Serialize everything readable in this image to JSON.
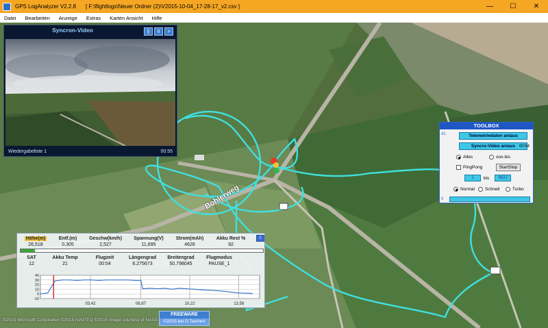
{
  "window": {
    "title": "GPS LogAnalyzer V2.2.8",
    "path": "[ F:\\flightlogs\\Neuer Ordner (2)\\V2015-10-04_17-28-17_v2.csv ]",
    "minimize": "—",
    "maximize": "☐",
    "close": "✕"
  },
  "menu": [
    "Datei",
    "Bearbeiten",
    "Anzeige",
    "Extras",
    "Karten Ansicht",
    "Hilfe"
  ],
  "video": {
    "title": "Syncron-Video",
    "buttons": [
      "||",
      "II",
      ">"
    ],
    "playlist": "Wiedergabeliste 1",
    "time": "00:55"
  },
  "toolbox": {
    "title": "TOOLBOX",
    "side_top": "41",
    "side_bottom": "0",
    "telemetry_button": "Telemetriedaten an/aus",
    "video_button": "Syncro-Video an/aus",
    "video_time": "00:54",
    "range_all": "Alles",
    "range_from_to": "von-bis",
    "pingpong": "PingPong",
    "startstop": "StartStop",
    "field_from": "1",
    "field_to_label": "bis",
    "field_to": "8621",
    "speed_normal": "Normal",
    "speed_fast": "Schnell",
    "speed_turbo": "Turbo"
  },
  "telemetry": {
    "row1_headers": [
      "Höhe(m)",
      "Entf.(m)",
      "Geschw(km/h)",
      "Spannung(V)",
      "Strom(mAh)",
      "Akku Rest %"
    ],
    "row1_values": [
      "26,518",
      "0,305",
      "2,527",
      "11,695",
      "4626",
      "92"
    ],
    "row2_headers": [
      "SAT",
      "Akku Temp",
      "Flugzeit",
      "Längengrad",
      "Breitengrad",
      "Flugmodus"
    ],
    "row2_values": [
      "12",
      "21",
      "00:54",
      "6.275673",
      "50.798045",
      "PAUSE_1"
    ],
    "button": "i",
    "akku_percent": 6
  },
  "chart_data": {
    "type": "line",
    "x": [
      0,
      0.5,
      1,
      1.5,
      2,
      2.5,
      3,
      3.5,
      4,
      4.5,
      5,
      5.5,
      6,
      6.5,
      6.87,
      7,
      7.5,
      8,
      8.5,
      9,
      9.5,
      10,
      10.5,
      11,
      11.5,
      12,
      12.5,
      13,
      13.58,
      14.5
    ],
    "series": [
      {
        "values": [
          0,
          2,
          28,
          30,
          30,
          29,
          30,
          30,
          29,
          30,
          30,
          30,
          30,
          29,
          29,
          11,
          12,
          11,
          12,
          10,
          12,
          11,
          10,
          9,
          8,
          7,
          6,
          4,
          2,
          1
        ]
      }
    ],
    "x_ticks": [
      "03,42",
      "06,87",
      "10,22",
      "13,58"
    ],
    "y_ticks": [
      "40",
      "30",
      "20",
      "10",
      "0",
      "-10"
    ],
    "ylim": [
      -10,
      40
    ],
    "xlim": [
      0,
      15
    ],
    "cursor_x": 0.9,
    "grid": true,
    "colors": {
      "line": "#3a78c8",
      "cursor": "#cc2222"
    }
  },
  "map": {
    "road_label": "Bohlerweg",
    "copyright": "©2015 Microsoft Corporation ©2015 NAVTEQ ©2015 Image courtesy of NASA"
  },
  "footer": {
    "freeware": "FREEWARE",
    "author": "©2015  bei D.Teichert"
  }
}
